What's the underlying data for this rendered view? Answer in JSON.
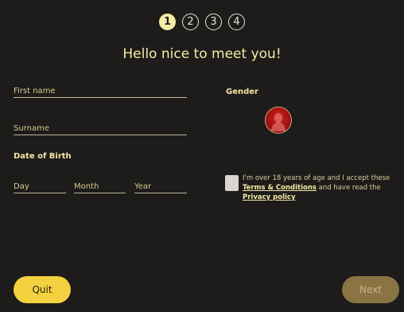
{
  "steps": [
    "1",
    "2",
    "3",
    "4"
  ],
  "title": "Hello nice to meet you!",
  "form": {
    "first_name_placeholder": "First name",
    "surname_placeholder": "Surname",
    "dob_label": "Date of Birth",
    "day_placeholder": "Day",
    "month_placeholder": "Month",
    "year_placeholder": "Year",
    "gender_label": "Gender"
  },
  "consent": {
    "text1": "I'm over 18 years of age and I accept these ",
    "terms_link": "Terms & Conditions",
    "text2": " and have read the ",
    "privacy_link": "Privacy policy"
  },
  "buttons": {
    "quit": "Quit",
    "next": "Next"
  }
}
